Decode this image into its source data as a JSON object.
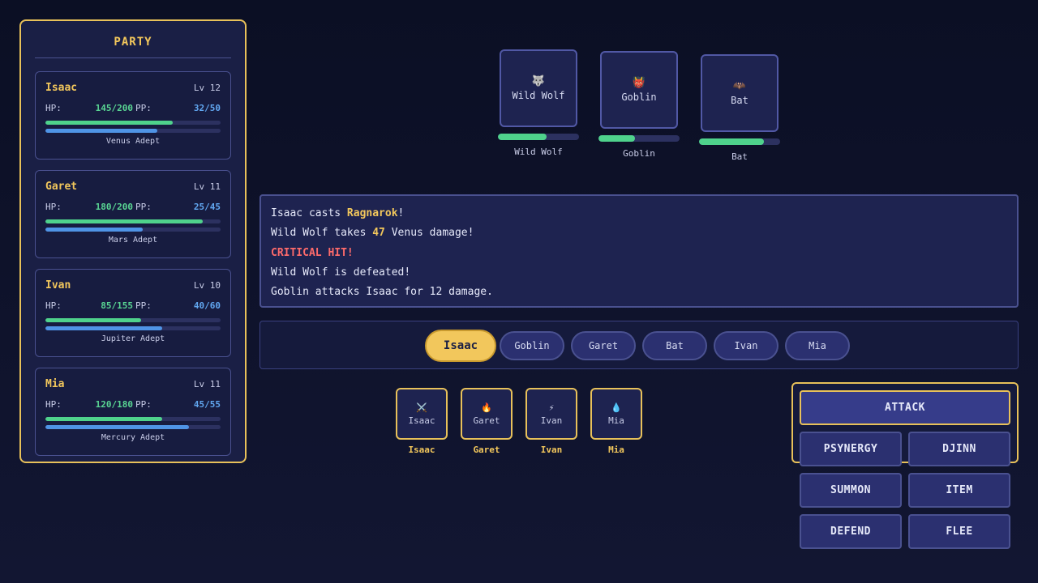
{
  "party": {
    "title": "PARTY",
    "members": [
      {
        "name": "Isaac",
        "level": "Lv 12",
        "hp_label": "HP:",
        "hp": "145/200",
        "pp_label": "PP:",
        "pp": "32/50",
        "hp_fraction": 0.725,
        "pp_fraction": 0.64,
        "class": "Venus Adept"
      },
      {
        "name": "Garet",
        "level": "Lv 11",
        "hp_label": "HP:",
        "hp": "180/200",
        "pp_label": "PP:",
        "pp": "25/45",
        "hp_fraction": 0.9,
        "pp_fraction": 0.556,
        "class": "Mars Adept"
      },
      {
        "name": "Ivan",
        "level": "Lv 10",
        "hp_label": "HP:",
        "hp": "85/155",
        "pp_label": "PP:",
        "pp": "40/60",
        "hp_fraction": 0.548,
        "pp_fraction": 0.667,
        "class": "Jupiter Adept"
      },
      {
        "name": "Mia",
        "level": "Lv 11",
        "hp_label": "HP:",
        "hp": "120/180",
        "pp_label": "PP:",
        "pp": "45/55",
        "hp_fraction": 0.667,
        "pp_fraction": 0.818,
        "class": "Mercury Adept"
      }
    ]
  },
  "enemies": [
    {
      "name": "Wild Wolf",
      "icon": "wolf-icon",
      "glyph": "🐺",
      "label": "Wild Wolf",
      "hp_fraction": 0.6
    },
    {
      "name": "Goblin",
      "icon": "goblin-icon",
      "glyph": "👹",
      "label": "Goblin",
      "hp_fraction": 0.45
    },
    {
      "name": "Bat",
      "icon": "bat-icon",
      "glyph": "🦇",
      "label": "Bat",
      "hp_fraction": 0.8
    }
  ],
  "log": {
    "line1_a": "Isaac casts ",
    "line1_b": "Ragnarok",
    "line1_c": "!",
    "line2_a": "Wild Wolf takes ",
    "line2_b": "47",
    "line2_c": " Venus damage!",
    "line3": "CRITICAL HIT!",
    "line4": "Wild Wolf is defeated!",
    "line5": "Goblin attacks Isaac for 12 damage."
  },
  "turn_order": [
    "Isaac",
    "Goblin",
    "Garet",
    "Bat",
    "Ivan",
    "Mia"
  ],
  "portraits": [
    {
      "name": "Isaac",
      "icon": "sword-icon",
      "glyph": "⚔️",
      "label": "Isaac"
    },
    {
      "name": "Garet",
      "icon": "fire-icon",
      "glyph": "🔥",
      "label": "Garet"
    },
    {
      "name": "Ivan",
      "icon": "lightning-icon",
      "glyph": "⚡",
      "label": "Ivan"
    },
    {
      "name": "Mia",
      "icon": "water-drop-icon",
      "glyph": "💧",
      "label": "Mia"
    }
  ],
  "commands": {
    "attack": "ATTACK",
    "psynergy": "PSYNERGY",
    "djinn": "DJINN",
    "summon": "SUMMON",
    "item": "ITEM",
    "defend": "DEFEND",
    "flee": "FLEE"
  },
  "colors": {
    "accent": "#f2c75c",
    "hp": "#4fd28c",
    "pp": "#4f94e6",
    "critical": "#ff6b6b"
  }
}
